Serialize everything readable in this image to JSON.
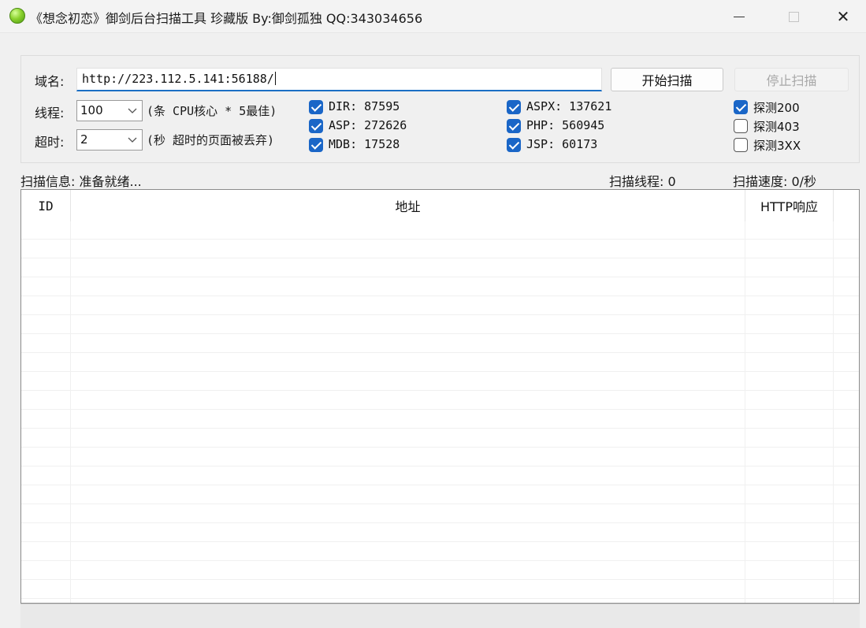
{
  "window": {
    "title": "《想念初恋》御剑后台扫描工具 珍藏版 By:御剑孤独 QQ:343034656",
    "close_glyph": "✕"
  },
  "form": {
    "domain_label": "域名:",
    "domain_value": "http://223.112.5.141:56188/",
    "start_label": "开始扫描",
    "stop_label": "停止扫描",
    "threads_label": "线程:",
    "threads_value": "100",
    "threads_hint": "(条 CPU核心 * 5最佳)",
    "timeout_label": "超时:",
    "timeout_value": "2",
    "timeout_hint": "(秒 超时的页面被丢弃)"
  },
  "dictionaries": [
    {
      "label": "DIR: 87595",
      "checked": true
    },
    {
      "label": "ASP: 272626",
      "checked": true
    },
    {
      "label": "MDB: 17528",
      "checked": true
    },
    {
      "label": "ASPX: 137621",
      "checked": true
    },
    {
      "label": "PHP: 560945",
      "checked": true
    },
    {
      "label": "JSP: 60173",
      "checked": true
    }
  ],
  "probes": [
    {
      "label": "探测200",
      "checked": true
    },
    {
      "label": "探测403",
      "checked": false
    },
    {
      "label": "探测3XX",
      "checked": false
    }
  ],
  "status": {
    "info": "扫描信息: 准备就绪...",
    "threads": "扫描线程: 0",
    "speed": "扫描速度: 0/秒"
  },
  "table": {
    "columns": [
      "ID",
      "地址",
      "HTTP响应"
    ],
    "rows": []
  },
  "colors": {
    "accent": "#1a66c7",
    "focus_underline": "#1a6fc4"
  }
}
